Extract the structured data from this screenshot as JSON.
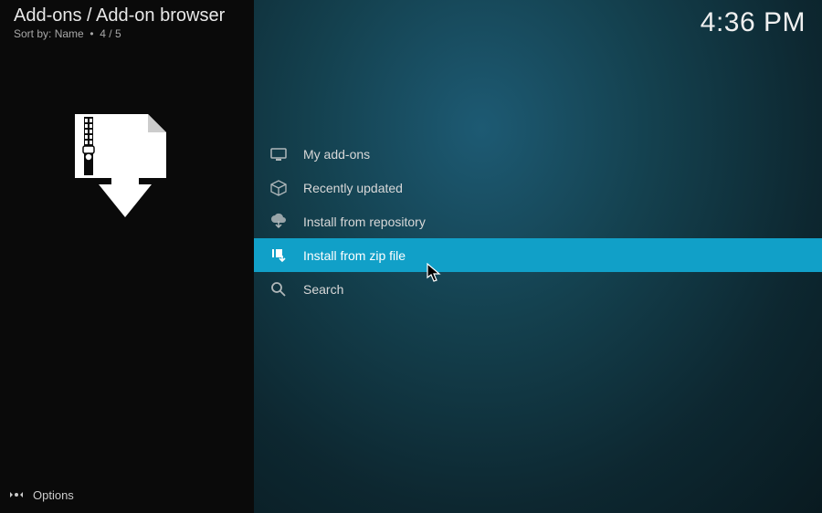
{
  "header": {
    "breadcrumb": "Add-ons / Add-on browser",
    "sort_label": "Sort by:",
    "sort_value": "Name",
    "position": "4 / 5"
  },
  "clock": "4:36 PM",
  "selected_index": 3,
  "menu": [
    {
      "icon": "monitor-icon",
      "label": "My add-ons"
    },
    {
      "icon": "box-icon",
      "label": "Recently updated"
    },
    {
      "icon": "cloud-download-icon",
      "label": "Install from repository"
    },
    {
      "icon": "zip-download-icon",
      "label": "Install from zip file"
    },
    {
      "icon": "search-icon",
      "label": "Search"
    }
  ],
  "footer": {
    "options_label": "Options"
  }
}
